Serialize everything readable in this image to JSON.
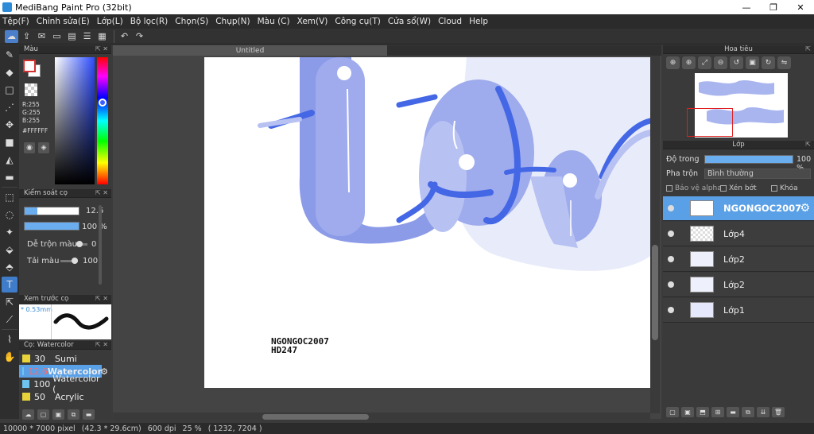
{
  "window": {
    "title": "MediBang Paint Pro (32bit)",
    "min": "—",
    "restore": "❐",
    "close": "✕"
  },
  "menu": [
    "Tệp(F)",
    "Chỉnh sửa(E)",
    "Lớp(L)",
    "Bộ lọc(R)",
    "Chọn(S)",
    "Chụp(N)",
    "Màu (C)",
    "Xem(V)",
    "Công cụ(T)",
    "Cửa sổ(W)",
    "Cloud",
    "Help"
  ],
  "color_panel": {
    "title": "Màu",
    "r": "R:255",
    "g": "G:255",
    "b": "B:255",
    "hex": "#FFFFFF"
  },
  "brush_control": {
    "title": "Kiểm soát cọ",
    "size_value": "12.6",
    "opacity_value": "100 %",
    "blend_label": "Dễ trộn màu",
    "blend_value": "0",
    "reload_label": "Tải màu",
    "reload_value": "100"
  },
  "brush_preview": {
    "title": "Xem trước cọ",
    "size": "* 0.53mm"
  },
  "brush_list": {
    "title": "Cọ: Watercolor",
    "items": [
      {
        "num": "30",
        "name": "Sumi",
        "color": "#e8d43a"
      },
      {
        "num": "12.6",
        "name": "Watercolor",
        "color": "#6ec4f0"
      },
      {
        "num": "100",
        "name": "Watercolor (",
        "color": "#6ec4f0"
      },
      {
        "num": "50",
        "name": "Acrylic",
        "color": "#e8d43a"
      }
    ]
  },
  "canvas": {
    "tab": "Untitled",
    "sign_line1": "NGONGOC2007",
    "sign_line2": "HD247"
  },
  "navigator": {
    "title": "Hoa tiêu"
  },
  "layer_panel": {
    "title": "Lớp",
    "opacity_label": "Độ trong",
    "opacity_value": "100 %",
    "blend_label": "Pha trộn",
    "blend_value": "Bình thường",
    "protect_alpha": "Bảo vệ alpha",
    "clip": "Xén bớt",
    "lock": "Khóa",
    "layers": [
      {
        "name": "NGONGOC2007",
        "selected": true
      },
      {
        "name": "Lớp4",
        "selected": false
      },
      {
        "name": "Lớp2",
        "selected": false
      },
      {
        "name": "Lớp2",
        "selected": false
      },
      {
        "name": "Lớp1",
        "selected": false
      }
    ]
  },
  "status": {
    "size": "10000 * 7000 pixel",
    "cm": "(42.3 * 29.6cm)",
    "dpi": "600 dpi",
    "zoom": "25 %",
    "coords": "( 1232, 7204 )"
  }
}
